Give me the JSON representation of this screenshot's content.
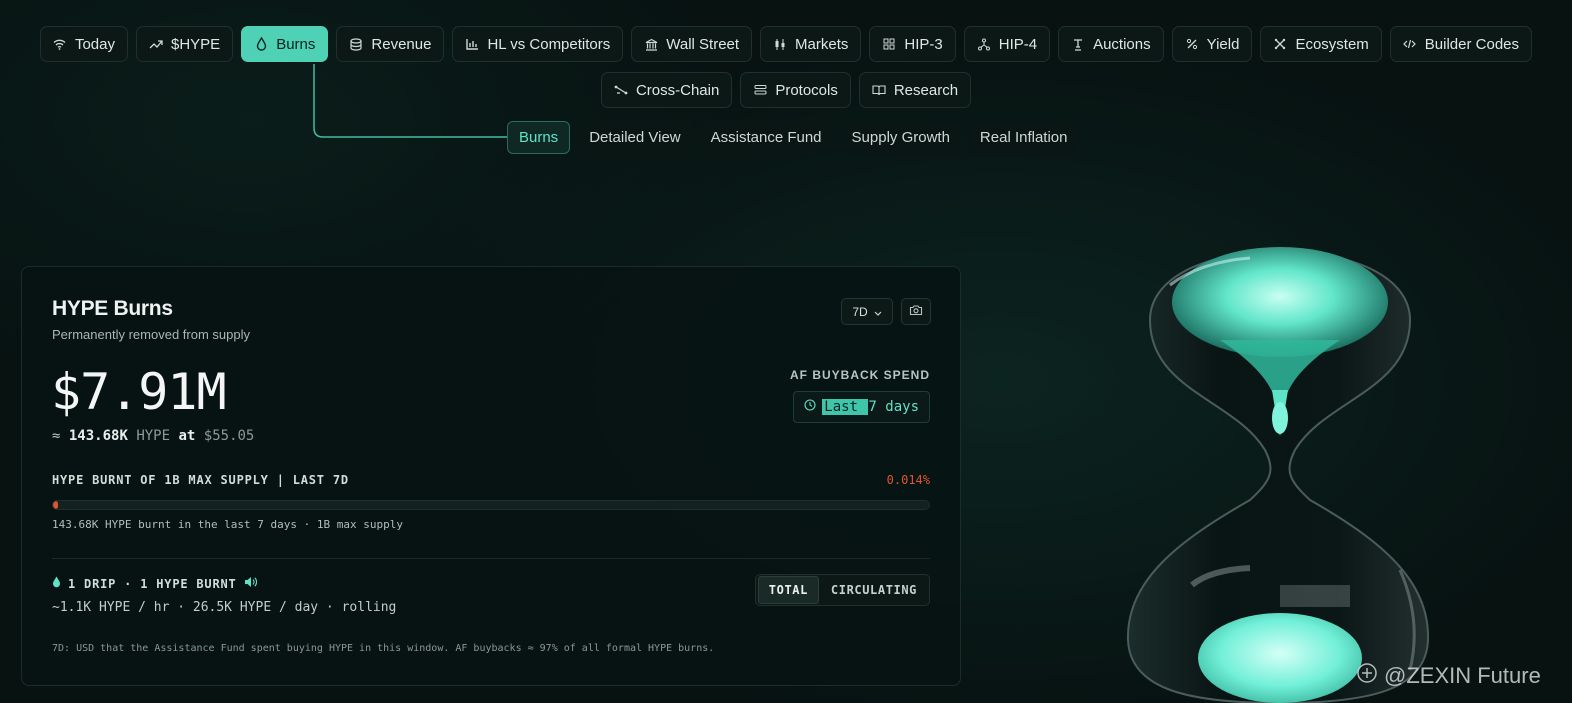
{
  "nav": {
    "primary": [
      {
        "label": "Today",
        "icon": "wifi-icon"
      },
      {
        "label": "$HYPE",
        "icon": "trend-up-icon"
      },
      {
        "label": "Burns",
        "icon": "drop-icon",
        "active": true
      },
      {
        "label": "Revenue",
        "icon": "database-icon"
      },
      {
        "label": "HL vs Competitors",
        "icon": "bar-chart-icon"
      },
      {
        "label": "Wall Street",
        "icon": "bank-icon"
      },
      {
        "label": "Markets",
        "icon": "candles-icon"
      },
      {
        "label": "HIP-3",
        "icon": "grid-icon"
      },
      {
        "label": "HIP-4",
        "icon": "fork-icon"
      },
      {
        "label": "Auctions",
        "icon": "gavel-icon"
      },
      {
        "label": "Yield",
        "icon": "percent-icon"
      },
      {
        "label": "Ecosystem",
        "icon": "network-icon"
      },
      {
        "label": "Builder Codes",
        "icon": "code-icon"
      }
    ],
    "secondary": [
      {
        "label": "Cross-Chain",
        "icon": "bridge-icon"
      },
      {
        "label": "Protocols",
        "icon": "layers-icon"
      },
      {
        "label": "Research",
        "icon": "book-icon"
      }
    ],
    "subtabs": [
      {
        "label": "Burns",
        "active": true
      },
      {
        "label": "Detailed View"
      },
      {
        "label": "Assistance Fund"
      },
      {
        "label": "Supply Growth"
      },
      {
        "label": "Real Inflation"
      }
    ]
  },
  "card": {
    "title": "HYPE Burns",
    "subtitle": "Permanently removed from supply",
    "range": "7D",
    "value": "$7.91M",
    "approx_prefix": "≈",
    "approx_amount": "143.68K",
    "approx_token": "HYPE",
    "approx_at": "at",
    "approx_price": "$55.05",
    "af_label": "AF BUYBACK SPEND",
    "af_period_highlight": "Last ",
    "af_period_rest": "7 days",
    "supply_label": "HYPE BURNT OF 1B MAX SUPPLY | LAST 7D",
    "supply_pct": "0.014%",
    "supply_fraction": 0.00014,
    "supply_note": "143.68K HYPE burnt in the last 7 days · 1B max supply",
    "drip_label": "1 DRIP · 1 HYPE BURNT",
    "rate": "~1.1K HYPE / hr · 26.5K HYPE / day · rolling",
    "toggle": [
      "TOTAL",
      "CIRCULATING"
    ],
    "footnote": "7D: USD that the Assistance Fund spent buying HYPE in this window. AF buybacks ≈ 97% of all formal HYPE burns."
  },
  "watermark": "@ZEXIN Future",
  "colors": {
    "accent": "#4fd1b5",
    "burn": "#e0552f",
    "background": "#071211"
  }
}
